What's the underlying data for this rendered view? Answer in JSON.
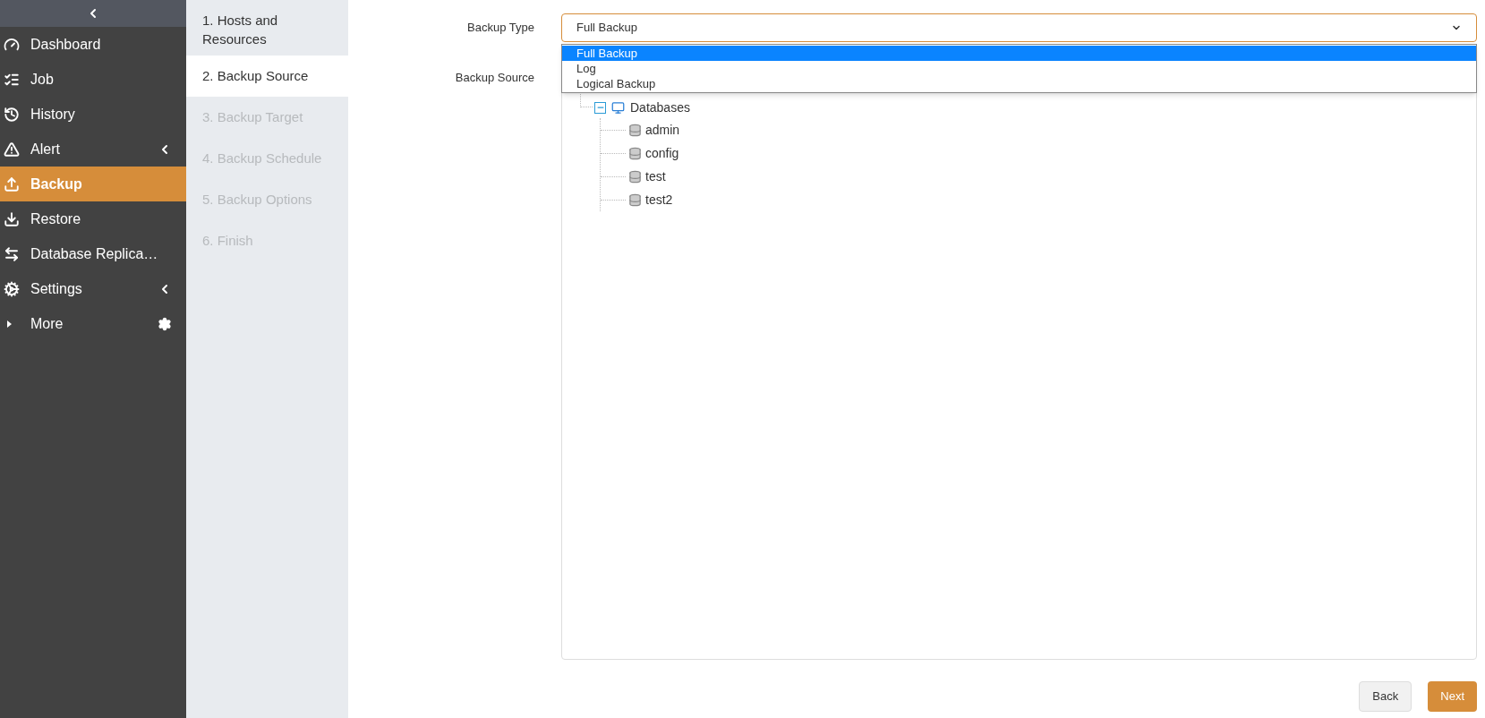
{
  "sidebar": {
    "items": [
      {
        "label": "Dashboard",
        "selected": false
      },
      {
        "label": "Job",
        "selected": false
      },
      {
        "label": "History",
        "selected": false
      },
      {
        "label": "Alert",
        "selected": false
      },
      {
        "label": "Backup",
        "selected": true
      },
      {
        "label": "Restore",
        "selected": false
      },
      {
        "label": "Database Replica…",
        "selected": false
      },
      {
        "label": "Settings",
        "selected": false
      },
      {
        "label": "More",
        "selected": false
      }
    ]
  },
  "steps": [
    {
      "label": "1. Hosts and Resources",
      "selected": false,
      "disabled": false
    },
    {
      "label": "2. Backup Source",
      "selected": true,
      "disabled": false
    },
    {
      "label": "3. Backup Target",
      "selected": false,
      "disabled": true
    },
    {
      "label": "4. Backup Schedule",
      "selected": false,
      "disabled": true
    },
    {
      "label": "5. Backup Options",
      "selected": false,
      "disabled": true
    },
    {
      "label": "6. Finish",
      "selected": false,
      "disabled": true
    }
  ],
  "form": {
    "backup_type": {
      "label": "Backup Type",
      "value": "Full Backup",
      "options": [
        {
          "label": "Full Backup",
          "selected": true
        },
        {
          "label": "Log",
          "selected": false
        },
        {
          "label": "Logical Backup",
          "selected": false
        }
      ]
    },
    "backup_source": {
      "label": "Backup Source",
      "tree": {
        "label": "Databases",
        "expanded": true,
        "children": [
          {
            "label": "admin"
          },
          {
            "label": "config"
          },
          {
            "label": "test"
          },
          {
            "label": "test2"
          }
        ]
      }
    }
  },
  "buttons": [
    {
      "label": "Back",
      "kind": "secondary"
    },
    {
      "label": "Next",
      "kind": "primary"
    }
  ]
}
